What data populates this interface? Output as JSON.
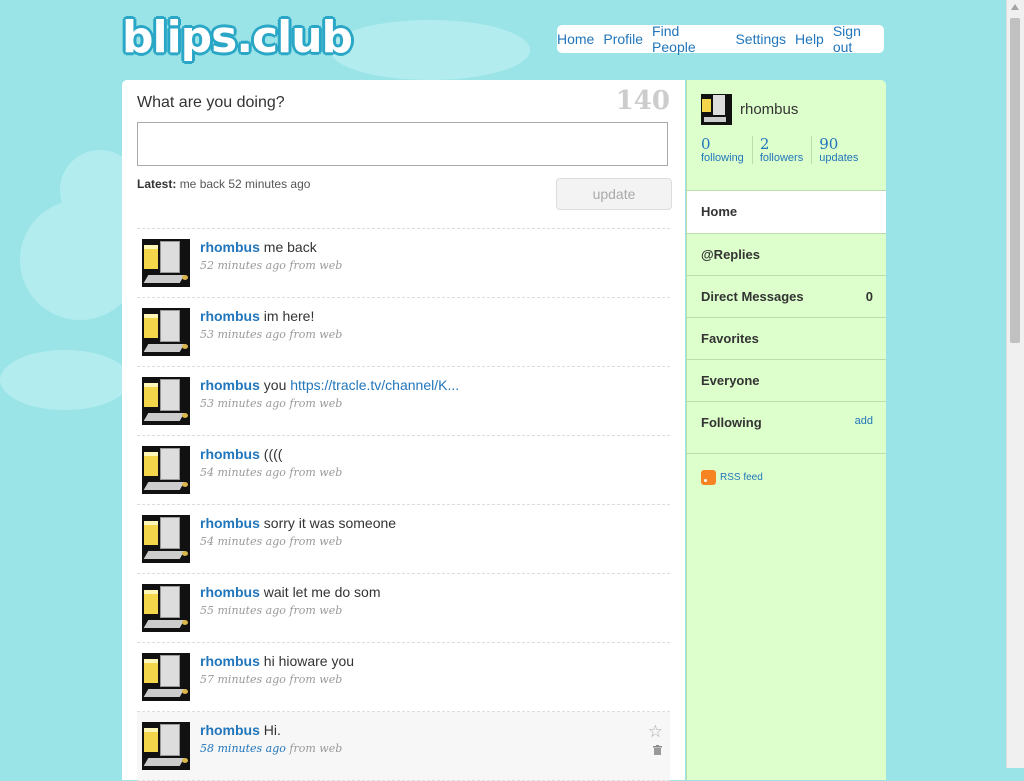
{
  "logo": "blips.club",
  "nav": [
    "Home",
    "Profile",
    "Find People",
    "Settings",
    "Help",
    "Sign out"
  ],
  "composer": {
    "prompt": "What are you doing?",
    "counter": "140",
    "latest_label": "Latest:",
    "latest_text": "me back 52 minutes ago",
    "update_label": "update"
  },
  "tweets": [
    {
      "user": "rhombus",
      "text": "me back",
      "time": "52 minutes ago",
      "source": "from web"
    },
    {
      "user": "rhombus",
      "text": "im here!",
      "time": "53 minutes ago",
      "source": "from web"
    },
    {
      "user": "rhombus",
      "text": "you",
      "link": "https://tracle.tv/channel/K...",
      "time": "53 minutes ago",
      "source": "from web"
    },
    {
      "user": "rhombus",
      "text": "((((",
      "time": "54 minutes ago",
      "source": "from web"
    },
    {
      "user": "rhombus",
      "text": "sorry it was someone",
      "time": "54 minutes ago",
      "source": "from web"
    },
    {
      "user": "rhombus",
      "text": "wait let me do som",
      "time": "55 minutes ago",
      "source": "from web"
    },
    {
      "user": "rhombus",
      "text": "hi hioware you",
      "time": "57 minutes ago",
      "source": "from web"
    },
    {
      "user": "rhombus",
      "text": "Hi.",
      "time": "58 minutes ago",
      "source": "from web"
    }
  ],
  "sidebar": {
    "username": "rhombus",
    "stats": [
      {
        "num": "0",
        "label": "following"
      },
      {
        "num": "2",
        "label": "followers"
      },
      {
        "num": "90",
        "label": "updates"
      }
    ],
    "menu": [
      {
        "label": "Home"
      },
      {
        "label": "@Replies"
      },
      {
        "label": "Direct Messages",
        "count": "0"
      },
      {
        "label": "Favorites"
      },
      {
        "label": "Everyone"
      },
      {
        "label": "Following",
        "add": "add"
      }
    ],
    "rss": "RSS feed"
  }
}
